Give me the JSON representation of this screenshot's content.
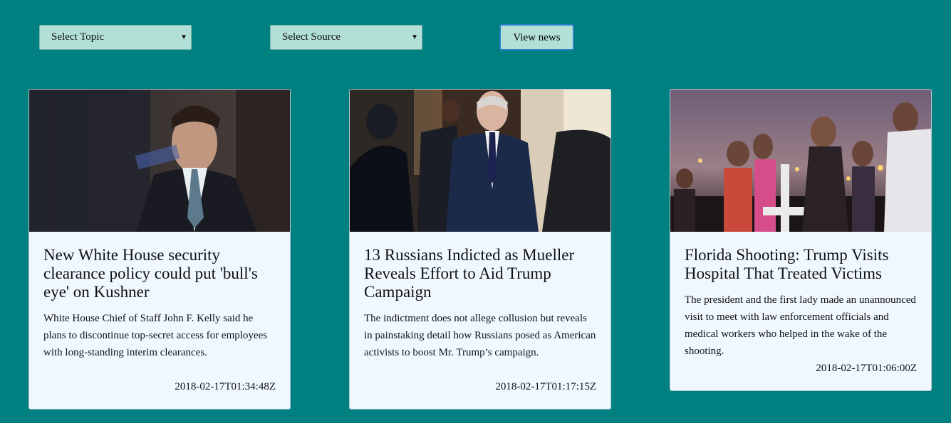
{
  "controls": {
    "topic_placeholder": "Select Topic",
    "source_placeholder": "Select Source",
    "view_button": "View news"
  },
  "colors": {
    "background": "#008080",
    "control_bg": "#b2dfd6",
    "card_bg": "#f0f8ff",
    "button_border": "#2a7fc9"
  },
  "articles": [
    {
      "title": "New White House security clearance policy could put 'bull's eye' on Kushner",
      "description": "White House Chief of Staff John F. Kelly said he plans to discontinue top-secret access for employees with long-standing interim clearances.",
      "published": "2018-02-17T01:34:48Z"
    },
    {
      "title": "13 Russians Indicted as Mueller Reveals Effort to Aid Trump Campaign",
      "description": "The indictment does not allege collusion but reveals in painstaking detail how Russians posed as American activists to boost Mr. Trump’s campaign.",
      "published": "2018-02-17T01:17:15Z"
    },
    {
      "title": "Florida Shooting: Trump Visits Hospital That Treated Victims",
      "description": "The president and the first lady made an unannounced visit to meet with law enforcement officials and medical workers who helped in the wake of the shooting.",
      "published": "2018-02-17T01:06:00Z"
    }
  ]
}
